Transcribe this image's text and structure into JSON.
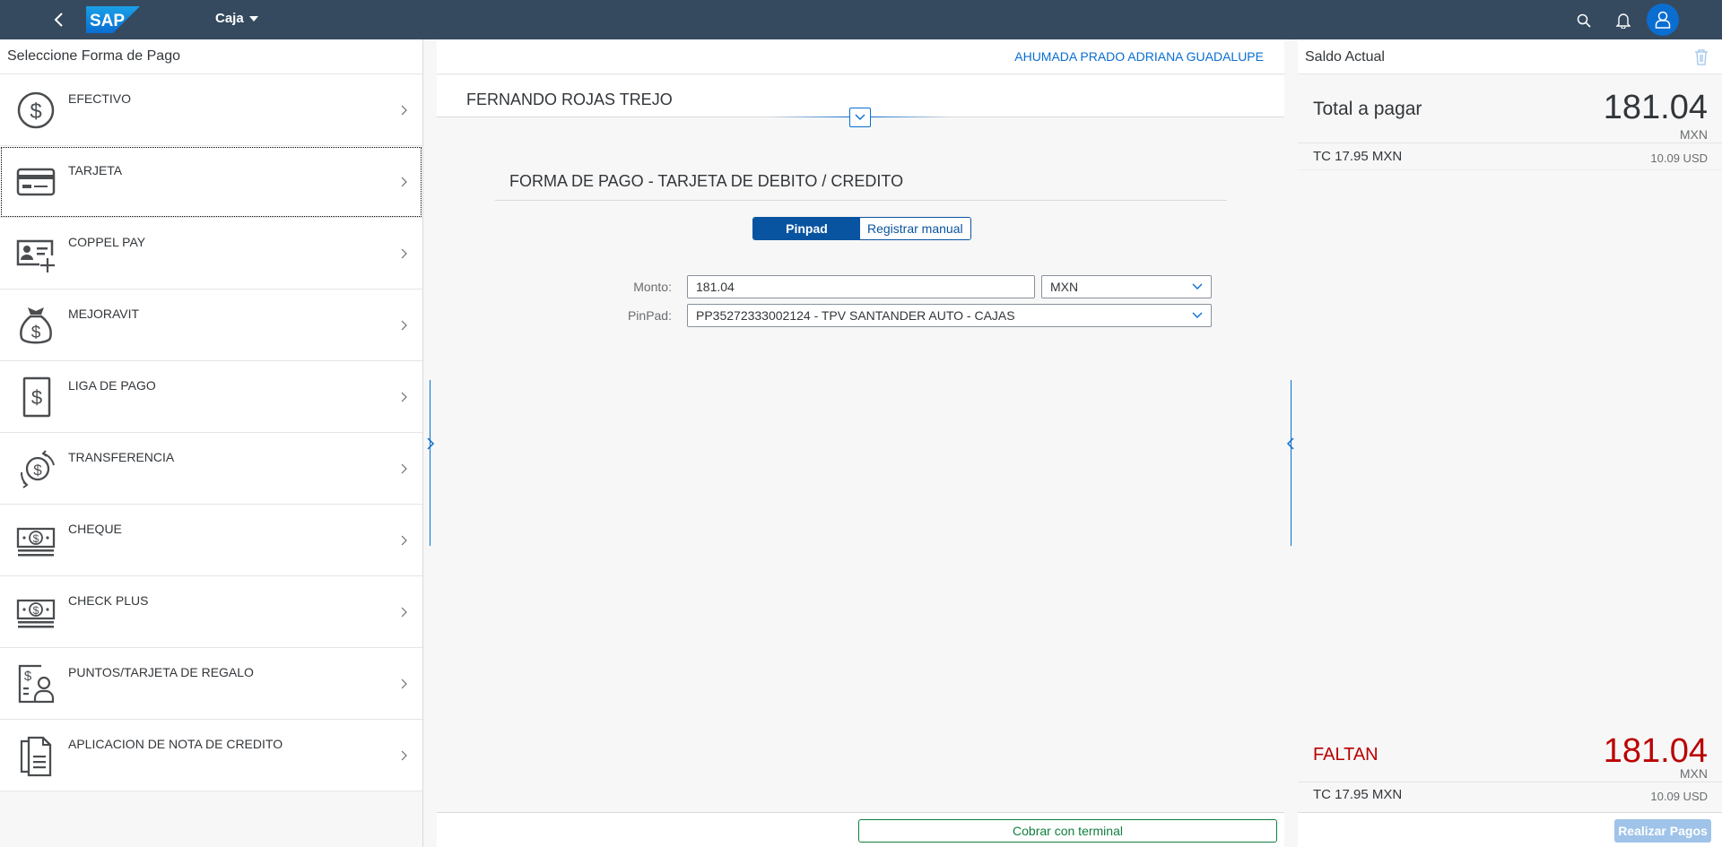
{
  "shell": {
    "back_icon": "back-arrow-icon",
    "logo_text": "SAP",
    "title": "Caja",
    "search_icon": "search-icon",
    "notifications_icon": "bell-icon",
    "user_icon": "user-avatar-icon"
  },
  "payment_methods": {
    "header": "Seleccione Forma de Pago",
    "items": [
      {
        "label": "EFECTIVO",
        "icon": "dollar-coin-icon"
      },
      {
        "label": "TARJETA",
        "icon": "credit-card-icon"
      },
      {
        "label": "COPPEL PAY",
        "icon": "id-card-add-icon"
      },
      {
        "label": "MEJORAVIT",
        "icon": "money-bag-icon"
      },
      {
        "label": "LIGA DE PAGO",
        "icon": "payment-document-icon"
      },
      {
        "label": "TRANSFERENCIA",
        "icon": "money-transfer-icon"
      },
      {
        "label": "CHEQUE",
        "icon": "cheque-icon"
      },
      {
        "label": "CHECK PLUS",
        "icon": "check-plus-icon"
      },
      {
        "label": "PUNTOS/TARJETA DE REGALO",
        "icon": "gift-points-icon"
      },
      {
        "label": "APLICACION DE NOTA DE CREDITO",
        "icon": "credit-note-icon"
      }
    ],
    "selected_index": 1
  },
  "center": {
    "cashier_name": "AHUMADA PRADO ADRIANA GUADALUPE",
    "customer_name": "FERNANDO ROJAS TREJO",
    "form_title": "FORMA DE PAGO - TARJETA DE DEBITO / CREDITO",
    "segments": {
      "active": "Pinpad",
      "inactive": "Registrar manual"
    },
    "monto_label": "Monto:",
    "monto_value": "181.04",
    "currency_value": "MXN",
    "pinpad_label": "PinPad:",
    "pinpad_value": "PP35272333002124 - TPV SANTANDER AUTO - CAJAS",
    "cobrar_button": "Cobrar con terminal"
  },
  "balance": {
    "title": "Saldo Actual",
    "total_label": "Total a pagar",
    "total_value": "181.04",
    "total_currency": "MXN",
    "tc_label": "TC 17.95 MXN",
    "tc_usd": "10.09 USD",
    "faltan_label": "FALTAN",
    "faltan_value": "181.04",
    "faltan_currency": "MXN",
    "faltan_tc_label": "TC 17.95 MXN",
    "faltan_tc_usd": "10.09 USD",
    "realizar_button": "Realizar Pagos"
  },
  "colors": {
    "shell": "#354a5f",
    "brand_blue": "#0a6ed1",
    "emphasized": "#0854a0",
    "success_green": "#107e3e",
    "negative_red": "#bb0000"
  }
}
